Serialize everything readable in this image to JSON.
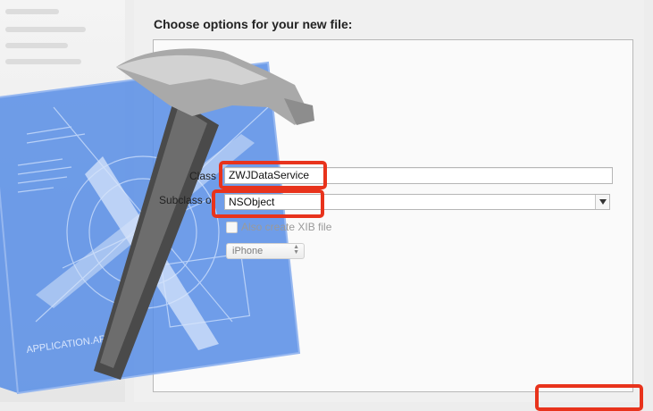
{
  "dialog": {
    "heading": "Choose options for your new file:"
  },
  "form": {
    "class_label": "Class",
    "class_value": "ZWJDataService",
    "subclass_label": "Subclass of",
    "subclass_value": "NSObject",
    "xib_label": "Also create XIB file",
    "xib_checked": false,
    "device_value": "iPhone"
  },
  "artwork": {
    "blueprint_text": "APPLICATION.APP",
    "blueprint_color": "#5b8fe6",
    "hammer_icon": "xcode-hammer-icon"
  },
  "annotations": {
    "highlight_color": "#e8331c"
  }
}
